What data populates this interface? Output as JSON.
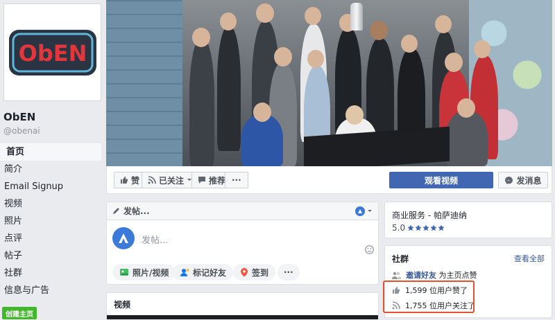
{
  "page": {
    "name": "ObEN",
    "handle": "@obenai",
    "logo_text": "ObEN"
  },
  "nav": {
    "items": [
      {
        "label": "首页",
        "active": true
      },
      {
        "label": "简介",
        "active": false
      },
      {
        "label": "Email Signup",
        "active": false
      },
      {
        "label": "视频",
        "active": false
      },
      {
        "label": "照片",
        "active": false
      },
      {
        "label": "点评",
        "active": false
      },
      {
        "label": "帖子",
        "active": false
      },
      {
        "label": "社群",
        "active": false
      },
      {
        "label": "信息与广告",
        "active": false
      }
    ],
    "create_page": "创建主页"
  },
  "actions": {
    "like": "赞",
    "following": "已关注",
    "share": "推荐",
    "more": "···",
    "watch_video": "观看视频",
    "message": "发消息"
  },
  "composer": {
    "header": "发帖...",
    "placeholder": "发帖...",
    "chips": [
      "照片/视频",
      "标记好友",
      "签到"
    ],
    "more": "···"
  },
  "videos": {
    "title": "视频"
  },
  "business": {
    "category": "商业服务 - 帕萨迪纳",
    "rating": "5.0",
    "stars": 5
  },
  "community": {
    "title": "社群",
    "see_all": "查看全部",
    "invite_link": "邀请好友",
    "invite_text": "为主页点赞",
    "likes": "1,599 位用户赞了",
    "follows": "1,755 位用户关注了"
  },
  "colors": {
    "brand_blue": "#4267b2",
    "link": "#365899",
    "highlight": "#e0522f",
    "logo_red": "#e2363b",
    "logo_dark": "#2b3442"
  }
}
